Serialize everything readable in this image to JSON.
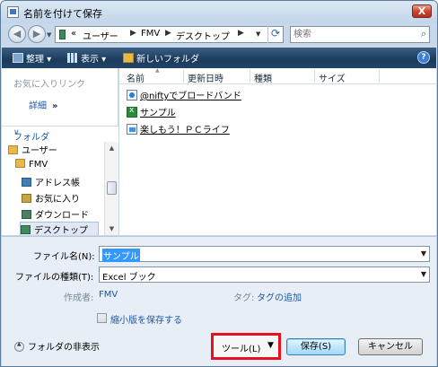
{
  "window": {
    "title": "名前を付けて保存",
    "close_label": "X"
  },
  "address": {
    "overflow": "«",
    "crumbs": [
      "ユーザー",
      "FMV",
      "デスクトップ"
    ],
    "search_placeholder": "検索"
  },
  "toolbar": {
    "organize": "整理",
    "views": "表示",
    "new_folder": "新しいフォルダ",
    "help": "?"
  },
  "sidebar": {
    "favorites_header": "お気に入りリンク",
    "details_label": "詳細",
    "details_chevron": "»",
    "folders_header": "フォルダ",
    "tree": [
      {
        "label": "ユーザー",
        "icon": "folder-icon"
      },
      {
        "label": "FMV",
        "icon": "folder-icon"
      },
      {
        "label": "アドレス帳",
        "icon": "contacts-icon"
      },
      {
        "label": "お気に入り",
        "icon": "favorites-icon"
      },
      {
        "label": "ダウンロード",
        "icon": "downloads-icon"
      },
      {
        "label": "デスクトップ",
        "icon": "desktop-icon"
      }
    ]
  },
  "filelist": {
    "columns": [
      "名前",
      "更新日時",
      "種類",
      "サイズ"
    ],
    "items": [
      {
        "name": "@niftyでブロードバンド",
        "icon": "web-shortcut-icon"
      },
      {
        "name": "サンプル",
        "icon": "excel-file-icon"
      },
      {
        "name": "楽しもう！ＰＣライフ",
        "icon": "shortcut-icon"
      }
    ]
  },
  "form": {
    "filename_label": "ファイル名(N):",
    "filename_value": "サンプル",
    "filetype_label": "ファイルの種類(T):",
    "filetype_value": "Excel ブック",
    "author_label": "作成者:",
    "author_value": "FMV",
    "tags_label": "タグ:",
    "tags_value": "タグの追加",
    "thumbnail_label": "縮小版を保存する",
    "thumbnail_checked": false,
    "hide_folders": "フォルダの非表示",
    "tools": "ツール(L)",
    "save": "保存(S)",
    "cancel": "キャンセル"
  },
  "colors": {
    "highlight_box": "#e8101c",
    "toolbar_bg": "#1b3a5c",
    "link": "#1c57a3"
  }
}
